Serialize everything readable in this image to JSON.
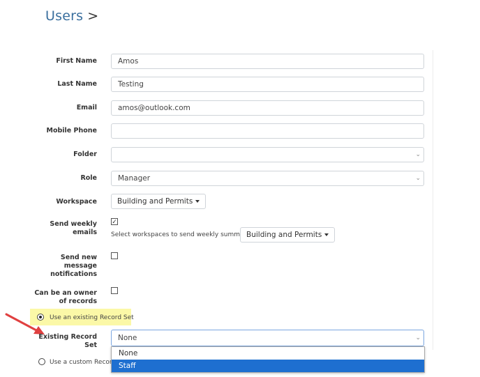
{
  "breadcrumb": {
    "title": "Users",
    "separator": ">"
  },
  "form": {
    "first_name": {
      "label": "First Name",
      "value": "Amos"
    },
    "last_name": {
      "label": "Last Name",
      "value": "Testing"
    },
    "email": {
      "label": "Email",
      "value": "amos@outlook.com"
    },
    "mobile_phone": {
      "label": "Mobile Phone",
      "value": ""
    },
    "folder": {
      "label": "Folder",
      "value": ""
    },
    "role": {
      "label": "Role",
      "value": "Manager"
    },
    "workspace": {
      "label": "Workspace",
      "value": "Building and Permits"
    },
    "weekly_emails": {
      "label_line1": "Send weekly",
      "label_line2": "emails",
      "checked": true,
      "check_glyph": "✓",
      "summary_text": "Select workspaces to send weekly summary for:",
      "summary_value": "Building and Permits"
    },
    "new_message": {
      "label_line1": "Send new",
      "label_line2": "message",
      "label_line3": "notifications",
      "checked": false
    },
    "record_owner": {
      "label_line1": "Can be an owner",
      "label_line2": "of records",
      "checked": false
    },
    "record_set_option_existing": "Use an existing Record Set",
    "existing_record_set": {
      "label_line1": "Existing Record",
      "label_line2": "Set",
      "value": "None",
      "options": [
        "None",
        "Staff"
      ],
      "highlighted_option": "Staff"
    },
    "record_set_option_custom": "Use a custom Record Set"
  },
  "colors": {
    "title": "#3a6f9e",
    "highlight": "#fbf8a7",
    "arrow": "#e04040",
    "selected_option": "#1e6fd0"
  },
  "icons": {
    "chevron": "chevron-down-icon",
    "arrow": "arrow-right-icon"
  }
}
